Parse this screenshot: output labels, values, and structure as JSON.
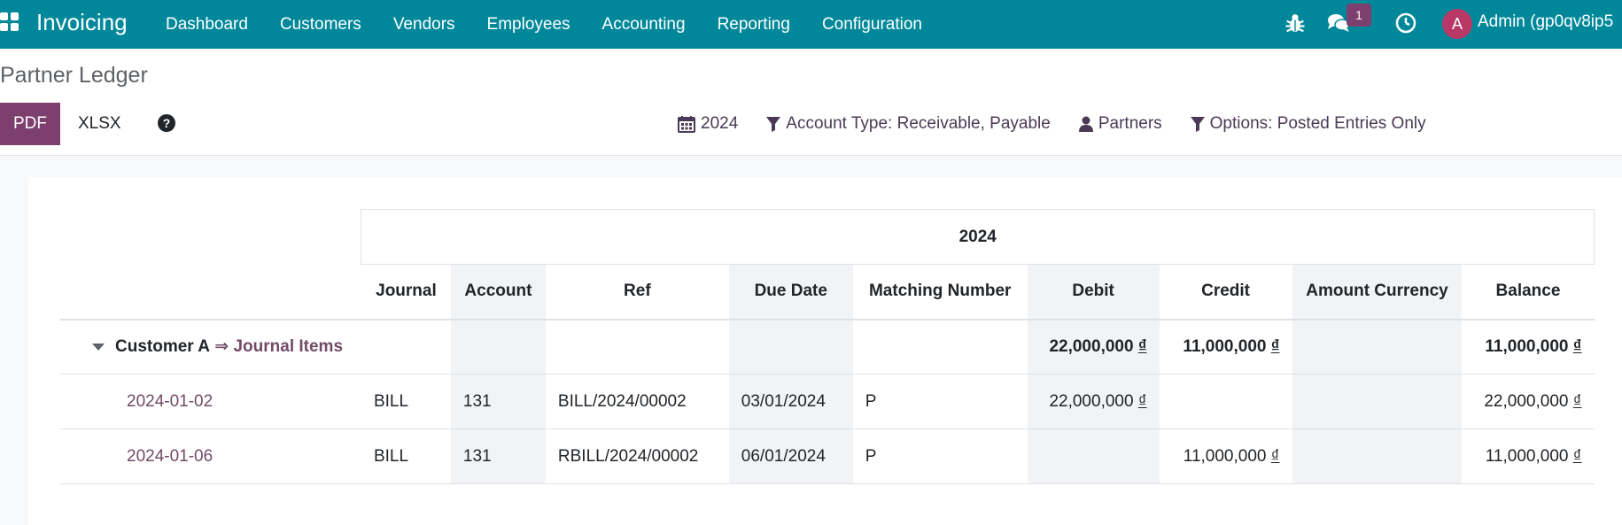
{
  "navbar": {
    "app_title": "Invoicing",
    "menu": [
      "Dashboard",
      "Customers",
      "Vendors",
      "Employees",
      "Accounting",
      "Reporting",
      "Configuration"
    ],
    "message_count": "1",
    "avatar_letter": "A",
    "user_name": "Admin (gp0qv8ip5"
  },
  "control_panel": {
    "title": "Partner Ledger",
    "pdf_label": "PDF",
    "xlsx_label": "XLSX",
    "help_icon": "?",
    "filters": {
      "period": "2024",
      "account_type": "Account Type: Receivable, Payable",
      "partners": "Partners",
      "options": "Options: Posted Entries Only"
    }
  },
  "report": {
    "period_header": "2024",
    "columns": [
      "Journal",
      "Account",
      "Ref",
      "Due Date",
      "Matching Number",
      "Debit",
      "Credit",
      "Amount Currency",
      "Balance"
    ],
    "group": {
      "partner": "Customer A",
      "arrow": "⇒",
      "link": "Journal Items",
      "debit": "22,000,000",
      "credit": "11,000,000",
      "balance": "11,000,000"
    },
    "currency_symbol": "₫",
    "rows": [
      {
        "date": "2024-01-02",
        "journal": "BILL",
        "account": "131",
        "ref": "BILL/2024/00002",
        "due_date": "03/01/2024",
        "matching": "P",
        "debit": "22,000,000",
        "credit": "",
        "amount_currency": "",
        "balance": "22,000,000"
      },
      {
        "date": "2024-01-06",
        "journal": "BILL",
        "account": "131",
        "ref": "RBILL/2024/00002",
        "due_date": "06/01/2024",
        "matching": "P",
        "debit": "",
        "credit": "11,000,000",
        "amount_currency": "",
        "balance": "11,000,000"
      }
    ]
  }
}
